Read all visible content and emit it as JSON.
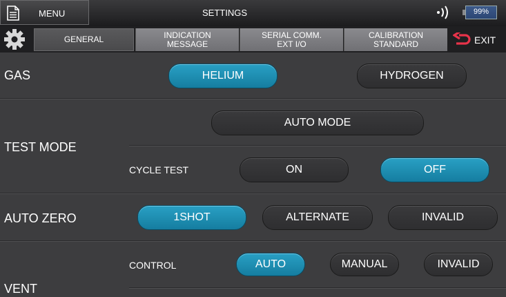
{
  "header": {
    "menu_label": "MENU",
    "title": "SETTINGS",
    "battery_label": "99%",
    "battery_level": 0.99
  },
  "tabs": [
    {
      "lines": [
        "GENERAL"
      ],
      "active": true
    },
    {
      "lines": [
        "INDICATION",
        "MESSAGE"
      ],
      "active": false
    },
    {
      "lines": [
        "SERIAL COMM.",
        "EXT I/O"
      ],
      "active": false
    },
    {
      "lines": [
        "CALIBRATION",
        "STANDARD"
      ],
      "active": false
    }
  ],
  "exit_label": "EXIT",
  "gas": {
    "label": "GAS",
    "options": [
      "HELIUM",
      "HYDROGEN"
    ],
    "selected": "HELIUM"
  },
  "test_mode": {
    "label": "TEST MODE",
    "auto_mode_label": "AUTO MODE",
    "cycle_test": {
      "label": "CYCLE TEST",
      "options": [
        "ON",
        "OFF"
      ],
      "selected": "OFF"
    }
  },
  "auto_zero": {
    "label": "AUTO ZERO",
    "options": [
      "1SHOT",
      "ALTERNATE",
      "INVALID"
    ],
    "selected": "1SHOT"
  },
  "vent": {
    "label": "VENT",
    "control": {
      "label": "CONTROL",
      "options": [
        "AUTO",
        "MANUAL",
        "INVALID"
      ],
      "selected": "AUTO"
    }
  }
}
